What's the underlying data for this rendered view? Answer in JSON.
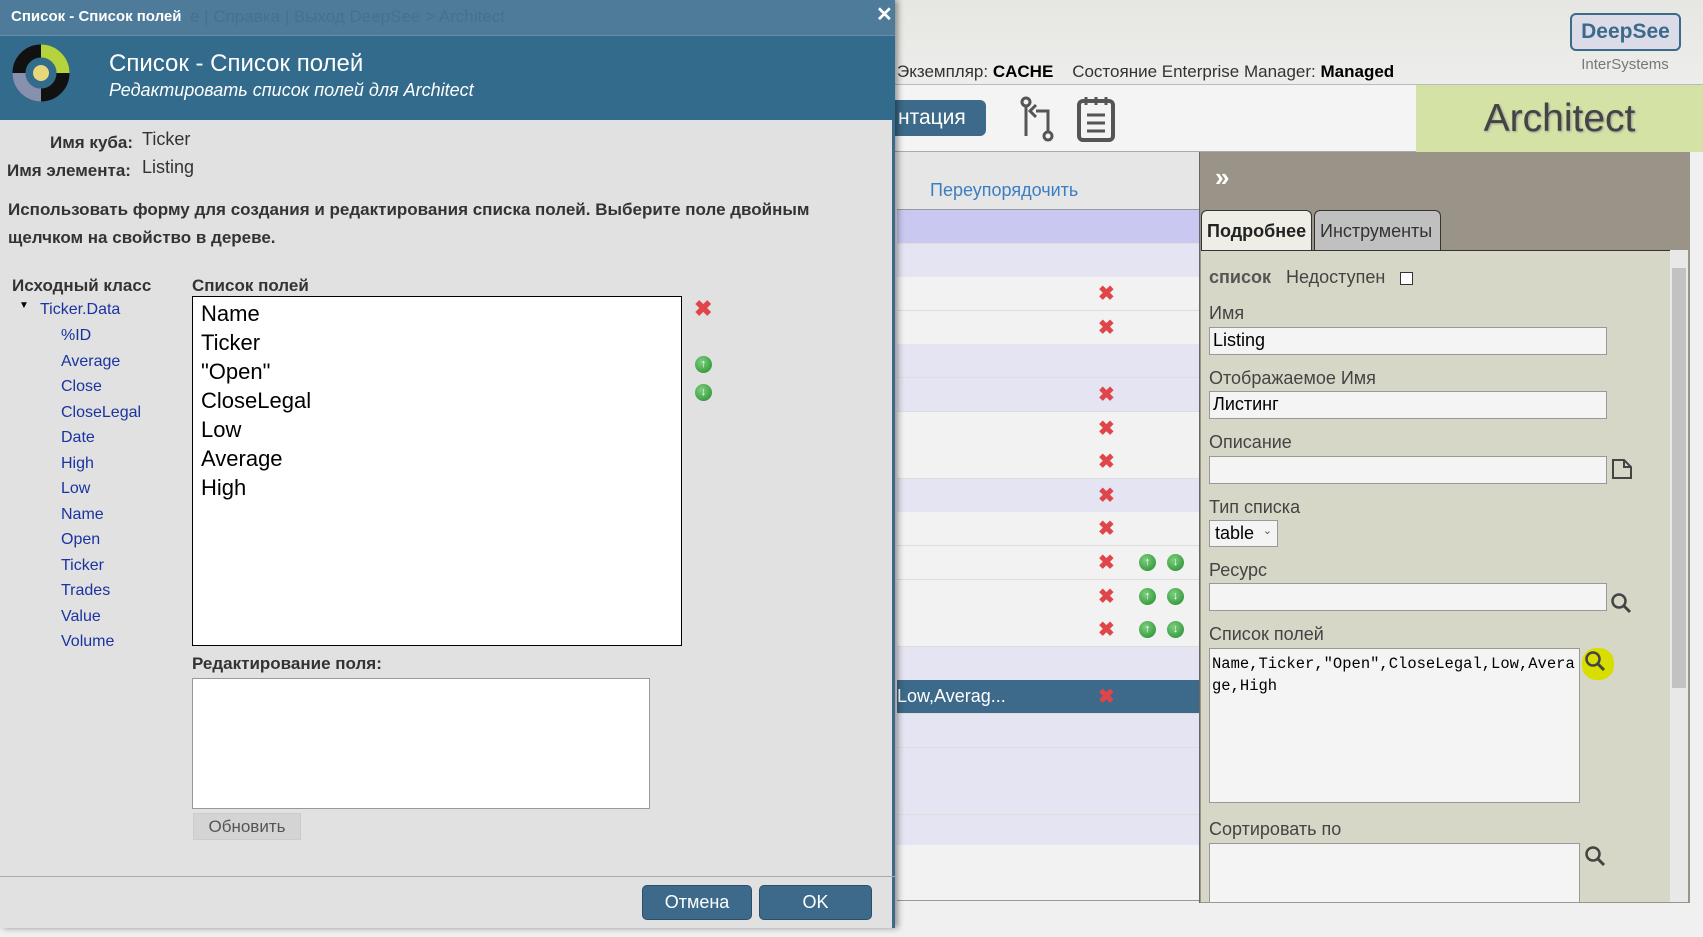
{
  "background": {
    "instance_label": "Экземпляр:",
    "instance_value": "CACHE",
    "em_label": "Состояние Enterprise Manager:",
    "em_value": "Managed",
    "logo": "DeepSee",
    "company": "InterSystems",
    "nav_button": "Документация",
    "nav_button_visible": "нтация",
    "toolbar_icons": [
      "compile-icon",
      "notepad-icon"
    ],
    "app_title": "Architect",
    "reorder_link": "Переупорядочить",
    "selected_row_text": "Low,Averag...",
    "collapse_glyph": "»",
    "tabs": [
      "Подробнее",
      "Инструменты"
    ],
    "details": {
      "type": "список",
      "disabled_label": "Недоступен",
      "disabled_checked": false,
      "name_label": "Имя",
      "name_value": "Listing",
      "display_label": "Отображаемое Имя",
      "display_value": "Листинг",
      "desc_label": "Описание",
      "desc_value": "",
      "list_type_label": "Тип списка",
      "list_type_value": "table",
      "resource_label": "Ресурс",
      "resource_value": "",
      "fields_label": "Список полей",
      "fields_value": "Name,Ticker,\"Open\",CloseLegal,Low,Average,High",
      "sort_label": "Сортировать по",
      "sort_value": ""
    },
    "highlight_color": "#d8de00"
  },
  "dialog": {
    "titlebar": "Список - Список полей",
    "ghost_text": "е | Справка | Выход          DeepSee > Architect",
    "title": "Список - Список полей",
    "subtitle": "Редактировать список полей для Architect",
    "cube_label": "Имя куба:",
    "cube_value": "Ticker",
    "element_label": "Имя элемента:",
    "element_value": "Listing",
    "instructions": "Использовать форму для создания и редактирования списка полей. Выберите поле двойным щелчком на свойство в дереве.",
    "source_class_label": "Исходный класс",
    "tree_root": "Ticker.Data",
    "tree_items": [
      "%ID",
      "Average",
      "Close",
      "CloseLegal",
      "Date",
      "High",
      "Low",
      "Name",
      "Open",
      "Ticker",
      "Trades",
      "Value",
      "Volume"
    ],
    "field_list_label": "Список полей",
    "field_list": [
      "Name",
      "Ticker",
      "\"Open\"",
      "CloseLegal",
      "Low",
      "Average",
      "High"
    ],
    "edit_field_label": "Редактирование поля:",
    "edit_field_value": "",
    "update_button": "Обновить",
    "cancel_button": "Отмена",
    "ok_button": "OK"
  }
}
